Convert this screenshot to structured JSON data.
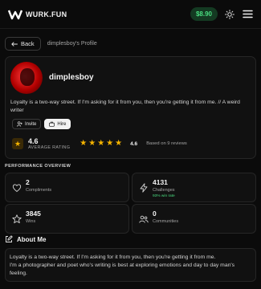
{
  "header": {
    "logo_text": "WURK.FUN",
    "balance": "$8.90",
    "icons": {
      "logo": "wurk-logo-mark",
      "theme": "sun-icon",
      "menu": "hamburger-menu-icon"
    }
  },
  "breadcrumb": {
    "back_label": "Back",
    "title": "dimplesboy's Profile"
  },
  "profile": {
    "username": "dimplesboy",
    "bio": "Loyalty is a two-way street. If I'm asking for it from you, then you're getting it from me. // A weird writer",
    "invite_label": "Invite",
    "hire_label": "Hire",
    "rating": "4.6",
    "rating_label": "AVERAGE RATING",
    "stars": 5,
    "rating_small": "4.6",
    "based_on": "Based on 9 reviews"
  },
  "performance": {
    "title": "PERFORMANCE OVERVIEW",
    "stats": [
      {
        "value": "2",
        "label": "Compliments",
        "icon": "heart-icon"
      },
      {
        "value": "4131",
        "label": "Challenges",
        "sub": "93% win rate",
        "icon": "lightning-icon"
      },
      {
        "value": "3845",
        "label": "Wins",
        "icon": "star-icon"
      },
      {
        "value": "0",
        "label": "Communities",
        "icon": "communities-icon"
      }
    ]
  },
  "about": {
    "title": "About Me",
    "line1": "Loyalty is a two-way street. If I'm asking for it from you, then you're getting it from me.",
    "line2": "I'm a photographer and poet who's writing is best at exploring emotions and day to day man's feeling."
  },
  "colors": {
    "background": "#0b0b0b",
    "card": "#111111",
    "accent_green": "#4ade80",
    "star": "#f5b400",
    "avatar_red": "#ff3b3b"
  }
}
